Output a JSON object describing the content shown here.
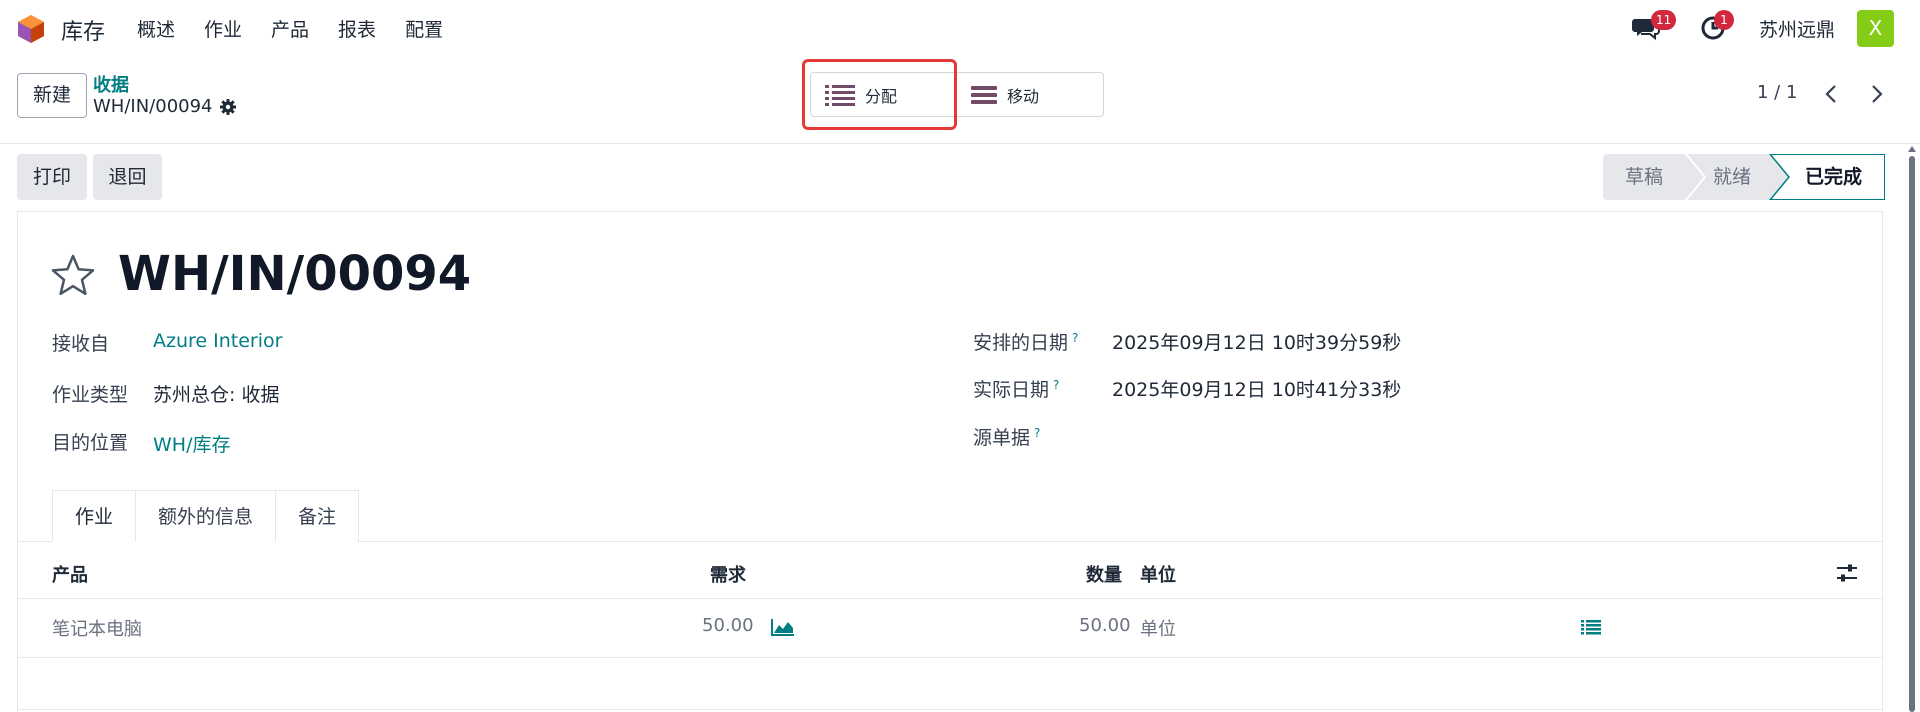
{
  "app": {
    "name": "库存"
  },
  "menu": [
    "概述",
    "作业",
    "产品",
    "报表",
    "配置"
  ],
  "systray": {
    "messages_count": "11",
    "activities_count": "1",
    "company": "苏州远鼎",
    "avatar_letter": "X"
  },
  "control": {
    "new_label": "新建",
    "breadcrumb_parent": "收据",
    "breadcrumb_current": "WH/IN/00094",
    "view_switch": [
      {
        "label": "分配",
        "icon": "list-icon"
      },
      {
        "label": "移动",
        "icon": "bars-icon"
      }
    ],
    "pager": "1 / 1"
  },
  "actions": {
    "print": "打印",
    "return": "退回"
  },
  "status": [
    "草稿",
    "就绪",
    "已完成"
  ],
  "record": {
    "title": "WH/IN/00094",
    "fields_left": [
      {
        "label": "接收自",
        "value": "Azure Interior",
        "link": true
      },
      {
        "label": "作业类型",
        "value": "苏州总仓: 收据",
        "link": false
      },
      {
        "label": "目的位置",
        "value": "WH/库存",
        "link": true
      }
    ],
    "fields_right": [
      {
        "label": "安排的日期",
        "value": "2025年09月12日 10时39分59秒"
      },
      {
        "label": "实际日期",
        "value": "2025年09月12日 10时41分33秒"
      },
      {
        "label": "源单据",
        "value": ""
      }
    ],
    "help_mark": "?"
  },
  "tabs": [
    "作业",
    "额外的信息",
    "备注"
  ],
  "table": {
    "headers": [
      "产品",
      "需求",
      "数量",
      "单位"
    ],
    "rows": [
      {
        "product": "笔记本电脑",
        "demand": "50.00",
        "quantity": "50.00",
        "uom": "单位"
      }
    ]
  },
  "colors": {
    "accent": "#017e84",
    "brand": "#714b67",
    "badge": "#d0283c",
    "highlight": "#e53935"
  }
}
